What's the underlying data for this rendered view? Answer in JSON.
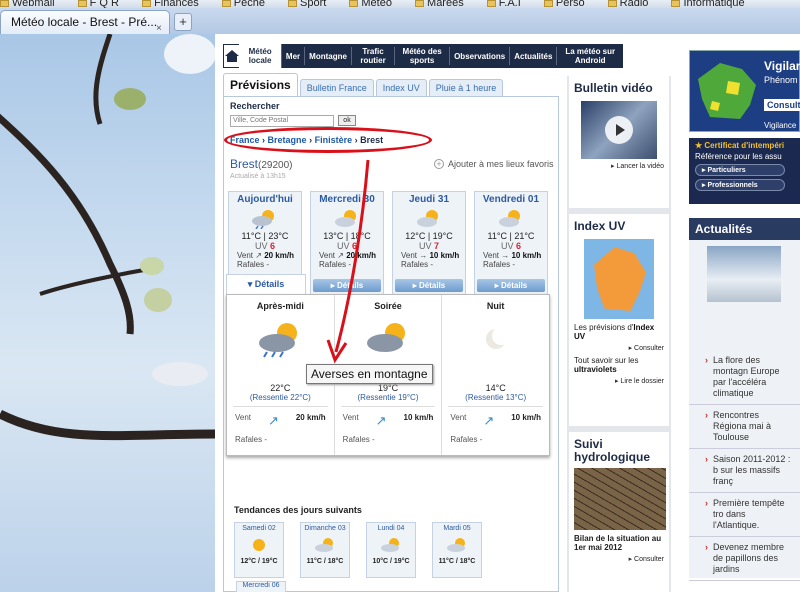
{
  "browser": {
    "bookmarks": [
      "Webmail",
      "F Q R",
      "Finances",
      "Pêche",
      "Sport",
      "Météo",
      "Marées",
      "F.A.I",
      "Perso",
      "Radio",
      "Informatique"
    ],
    "tab_title": "Météo locale - Brest - Pré...",
    "tab_close": "×",
    "new_tab": "+"
  },
  "nav": {
    "items": [
      "Météo locale",
      "Mer",
      "Montagne",
      "Trafic routier",
      "Météo des sports",
      "Observations",
      "Actualités",
      "La météo sur Android"
    ]
  },
  "prev": {
    "tabs": [
      "Prévisions",
      "Bulletin France",
      "Index UV",
      "Pluie à 1 heure"
    ],
    "search_label": "Rechercher",
    "search_placeholder": "Ville, Code Postal",
    "ok": "ok",
    "crumb": [
      "France",
      "Bretagne",
      "Finistère",
      "Brest"
    ],
    "crumb_sep": "›",
    "city": "Brest",
    "cp": "(29200)",
    "maj": "Actualisé à 13h15",
    "fav": "Ajouter à mes lieux favoris",
    "fav_plus": "+"
  },
  "days": [
    {
      "name": "Aujourd'hui",
      "temp": "11°C | 23°C",
      "uv_label": "UV",
      "uv": "6",
      "vent_label": "Vent",
      "vent": "20 km/h",
      "raf": "Rafales -",
      "det": "Détails"
    },
    {
      "name": "Mercredi 30",
      "temp": "13°C | 18°C",
      "uv_label": "UV",
      "uv": "6",
      "vent_label": "Vent",
      "vent": "20 km/h",
      "raf": "Rafales -",
      "det": "Détails"
    },
    {
      "name": "Jeudi 31",
      "temp": "12°C | 19°C",
      "uv_label": "UV",
      "uv": "7",
      "vent_label": "Vent",
      "vent": "10 km/h",
      "raf": "Rafales -",
      "det": "Détails"
    },
    {
      "name": "Vendredi 01",
      "temp": "11°C | 21°C",
      "uv_label": "UV",
      "uv": "6",
      "vent_label": "Vent",
      "vent": "10 km/h",
      "raf": "Rafales -",
      "det": "Détails"
    }
  ],
  "periods": [
    {
      "name": "Après-midi",
      "temp": "22°C",
      "ress": "(Ressentie 22°C)",
      "vent_label": "Vent",
      "vent": "20 km/h",
      "raf": "Rafales -"
    },
    {
      "name": "Soirée",
      "temp": "19°C",
      "ress": "(Ressentie 19°C)",
      "vent_label": "Vent",
      "vent": "10 km/h",
      "raf": "Rafales -"
    },
    {
      "name": "Nuit",
      "temp": "14°C",
      "ress": "(Ressentie 13°C)",
      "vent_label": "Vent",
      "vent": "10 km/h",
      "raf": "Rafales -"
    }
  ],
  "tooltip": "Averses en montagne",
  "tendances": {
    "title": "Tendances des jours suivants",
    "days": [
      {
        "name": "Samedi 02",
        "temp": "12°C / 19°C"
      },
      {
        "name": "Dimanche 03",
        "temp": "11°C / 18°C"
      },
      {
        "name": "Lundi 04",
        "temp": "10°C / 19°C"
      },
      {
        "name": "Mardi 05",
        "temp": "11°C / 18°C"
      }
    ],
    "next": "Mercredi 06"
  },
  "side": {
    "video_title": "Bulletin vidéo",
    "video_link": "Lancer la vidéo",
    "uv_title": "Index UV",
    "uv_text1": "Les prévisions d'",
    "uv_text1b": "Index UV",
    "uv_link1": "Consulter",
    "uv_text2": "Tout savoir sur les ",
    "uv_text2b": "ultraviolets",
    "uv_link2": "Lire le dossier",
    "hydro_title": "Suivi hydrologique",
    "hydro_text": "Bilan de la situation au 1er mai 2012",
    "hydro_link": "Consulter"
  },
  "right": {
    "vig_title": "Vigilar",
    "vig_sub": "Phénom",
    "vig_consult": "Consulte",
    "vig_vig": "Vigilance",
    "cert_title": "Certificat d'intempéri",
    "cert_sub": "Référence pour les assu",
    "cert_b1": "Particuliers",
    "cert_b2": "Professionnels",
    "actu_title": "Actualités",
    "actu_items": [
      "La flore des montagn Europe par l'accéléra climatique",
      "Rencontres Régiona mai à Toulouse",
      "Saison 2011-2012 : b sur les massifs franç",
      "Première tempête tro dans l'Atlantique.",
      "Devenez membre de papillons des jardins"
    ]
  },
  "colors": {
    "nav": "#1e2b46",
    "accent": "#2c5aa0",
    "uv_red": "#d23",
    "annotation": "#d9101a"
  }
}
